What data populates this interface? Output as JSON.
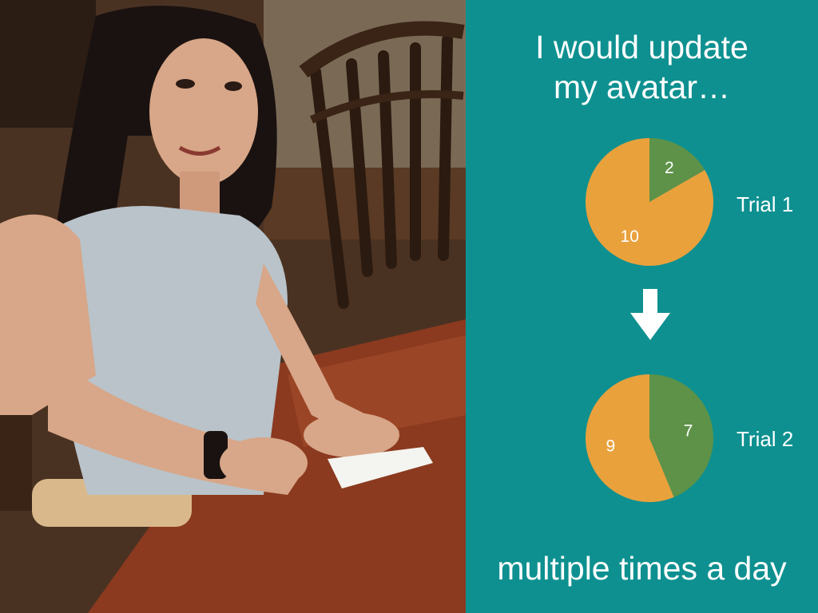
{
  "slide": {
    "title_line1": "I would update",
    "title_line2": "my avatar…",
    "footer": "multiple times a day",
    "photo_description_icon": "photo-of-woman-using-phone"
  },
  "colors": {
    "background": "#0e9090",
    "slice_orange": "#e9a13c",
    "slice_green": "#5d9248",
    "text": "#ffffff",
    "arrow": "#ffffff"
  },
  "chart_data": [
    {
      "type": "pie",
      "label": "Trial 1",
      "slices": [
        {
          "value": 2,
          "color": "#5d9248"
        },
        {
          "value": 10,
          "color": "#e9a13c"
        }
      ]
    },
    {
      "type": "pie",
      "label": "Trial 2",
      "slices": [
        {
          "value": 7,
          "color": "#5d9248"
        },
        {
          "value": 9,
          "color": "#e9a13c"
        }
      ]
    }
  ]
}
